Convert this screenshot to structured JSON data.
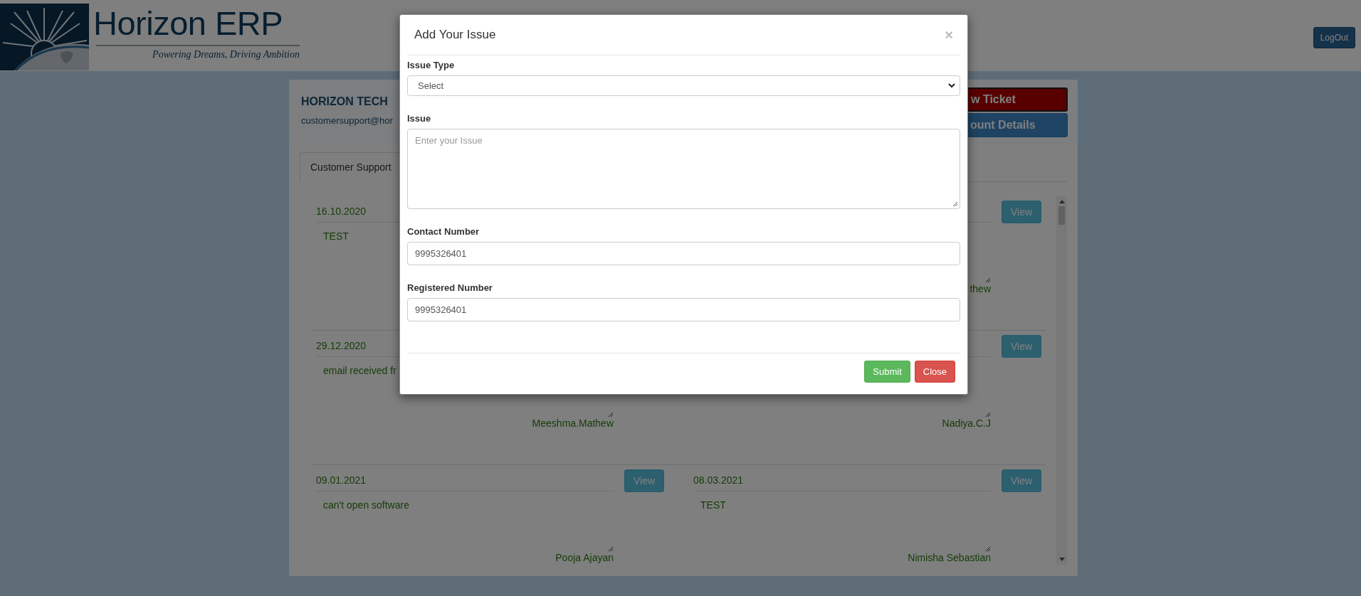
{
  "header": {
    "title": "Horizon ERP",
    "tagline": "Powering Dreams, Driving Ambition",
    "logout": "LogOut"
  },
  "company": {
    "name": "HORIZON TECH",
    "email": "customersupport@hor"
  },
  "actions": [
    {
      "label": "w Ticket",
      "kind": "danger"
    },
    {
      "label": "ount Details",
      "kind": "primary"
    }
  ],
  "tabs": [
    {
      "label": "Customer Support",
      "selected": true
    }
  ],
  "tickets": [
    {
      "date": "16.10.2020",
      "issue": "TEST"
    },
    {
      "view": "View",
      "author": "thew"
    },
    {
      "date": "29.12.2020",
      "issue": "email received fr",
      "author": "Meeshma.Mathew"
    },
    {
      "view": "View",
      "author": "Nadiya.C.J"
    },
    {
      "date": "09.01.2021",
      "issue": "can't open software",
      "view": "View",
      "author": "Pooja Ajayan"
    },
    {
      "date": "08.03.2021",
      "issue": "TEST",
      "view": "View",
      "author": "Nimisha Sebastian"
    }
  ],
  "modal": {
    "title": "Add Your Issue",
    "close": "×",
    "fields": [
      {
        "label": "Issue Type",
        "kind": "select",
        "value": "Select"
      },
      {
        "label": "Issue",
        "kind": "textarea",
        "placeholder": "Enter your Issue"
      },
      {
        "label": "Contact Number",
        "kind": "input",
        "value": "9995326401"
      },
      {
        "label": "Registered Number",
        "kind": "input",
        "value": "9995326401"
      }
    ],
    "buttons": [
      {
        "label": "Submit",
        "kind": "success"
      },
      {
        "label": "Close",
        "kind": "danger"
      }
    ]
  }
}
